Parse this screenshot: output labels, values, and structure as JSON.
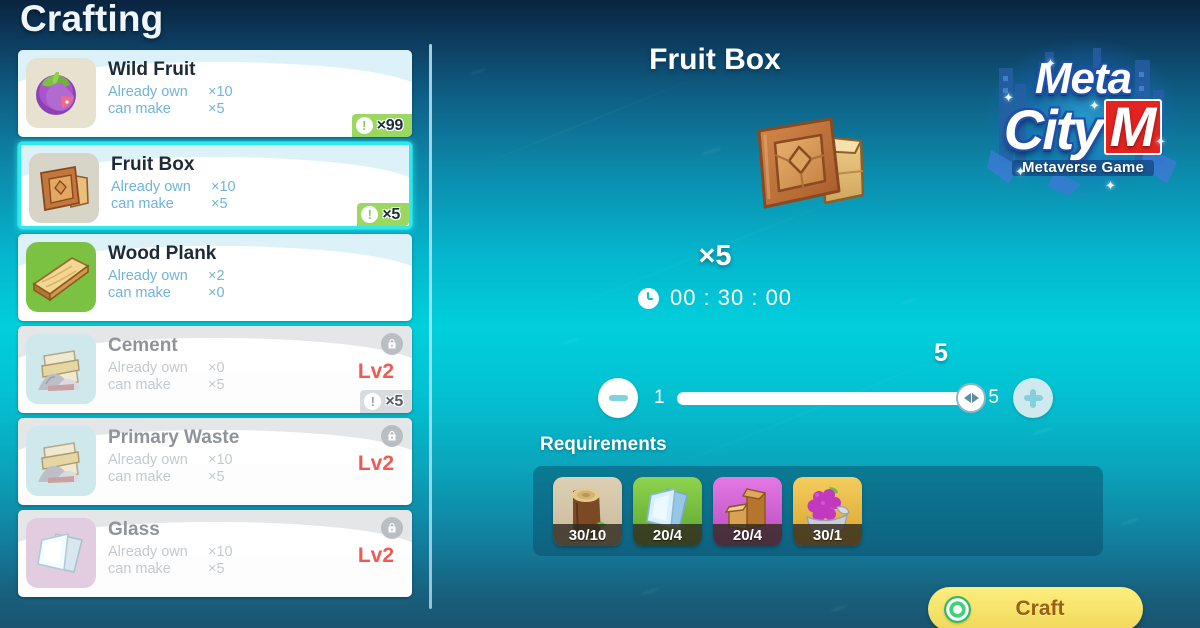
{
  "page": {
    "title": "Crafting",
    "accent_cyan": "#2fe9ec",
    "accent_yellow": "#f7e36a",
    "locked_level_color": "#f05a52"
  },
  "craft_list": {
    "items": [
      {
        "name": "Wild Fruit",
        "own_label": "Already own",
        "own_value": "×10",
        "make_label": "can make",
        "make_value": "×5",
        "badge": "×99",
        "badge_icon": "exclamation-icon",
        "selected": false,
        "locked": false,
        "lock_level": "",
        "thumb": "wild-fruit-icon"
      },
      {
        "name": "Fruit Box",
        "own_label": "Already own",
        "own_value": "×10",
        "make_label": "can make",
        "make_value": "×5",
        "badge": "×5",
        "badge_icon": "exclamation-icon",
        "selected": true,
        "locked": false,
        "lock_level": "",
        "thumb": "fruit-box-icon"
      },
      {
        "name": "Wood Plank",
        "own_label": "Already own",
        "own_value": "×2",
        "make_label": "can make",
        "make_value": "×0",
        "badge": "",
        "badge_icon": "",
        "selected": false,
        "locked": false,
        "lock_level": "",
        "thumb": "wood-plank-icon"
      },
      {
        "name": "Cement",
        "own_label": "Already own",
        "own_value": "×0",
        "make_label": "can make",
        "make_value": "×5",
        "badge": "×5",
        "badge_icon": "exclamation-icon",
        "selected": false,
        "locked": true,
        "lock_level": "Lv2",
        "thumb": "cement-icon"
      },
      {
        "name": "Primary Waste",
        "own_label": "Already own",
        "own_value": "×10",
        "make_label": "can make",
        "make_value": "×5",
        "badge": "",
        "badge_icon": "",
        "selected": false,
        "locked": true,
        "lock_level": "Lv2",
        "thumb": "primary-waste-icon"
      },
      {
        "name": "Glass",
        "own_label": "Already own",
        "own_value": "×10",
        "make_label": "can make",
        "make_value": "×5",
        "badge": "",
        "badge_icon": "",
        "selected": false,
        "locked": true,
        "lock_level": "Lv2",
        "thumb": "glass-icon"
      }
    ]
  },
  "detail": {
    "title": "Fruit Box",
    "output_count": "×5",
    "craft_time": "00 : 30 : 00",
    "quantity": {
      "min_label": "1",
      "max_label": "5",
      "current_label": "5",
      "decrease_icon": "minus-icon",
      "increase_icon": "plus-icon",
      "knob_icon": "left-right-arrows-icon"
    },
    "requirements_label": "Requirements",
    "requirements": [
      {
        "name": "log",
        "qty": "30/10"
      },
      {
        "name": "glass-sheet",
        "qty": "20/4"
      },
      {
        "name": "wood-block",
        "qty": "20/4"
      },
      {
        "name": "grape-basket",
        "qty": "30/1"
      }
    ],
    "craft_button": {
      "label": "Craft",
      "icon": "green-target-icon"
    }
  },
  "logo": {
    "line1": "Meta",
    "line2a": "City",
    "line2b": "M",
    "subtitle": "Metaverse Game"
  }
}
